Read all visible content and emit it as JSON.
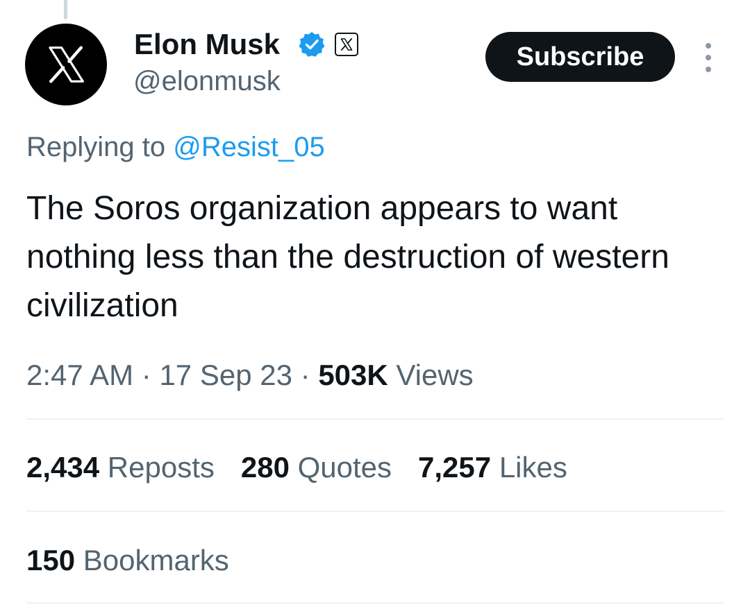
{
  "author": {
    "display_name": "Elon Musk",
    "handle": "@elonmusk",
    "avatar_icon": "x-logo-icon",
    "verified_icon": "verified-badge-icon",
    "affiliate_icon": "x-affiliate-badge-icon"
  },
  "actions": {
    "subscribe_label": "Subscribe",
    "more_icon": "more-vertical-icon"
  },
  "reply": {
    "prefix": "Replying to",
    "mention": "@Resist_05"
  },
  "tweet": {
    "text": "The Soros organization appears to want nothing less than the destruction of western civilization"
  },
  "meta": {
    "time": "2:47 AM",
    "separator": "·",
    "date": "17 Sep 23",
    "views_count": "503K",
    "views_label": "Views"
  },
  "stats": {
    "reposts_count": "2,434",
    "reposts_label": "Reposts",
    "quotes_count": "280",
    "quotes_label": "Quotes",
    "likes_count": "7,257",
    "likes_label": "Likes",
    "bookmarks_count": "150",
    "bookmarks_label": "Bookmarks"
  },
  "colors": {
    "text_primary": "#0f1419",
    "text_secondary": "#536471",
    "accent": "#1d9bf0",
    "divider": "#eff3f4",
    "button_bg": "#0f1419"
  }
}
